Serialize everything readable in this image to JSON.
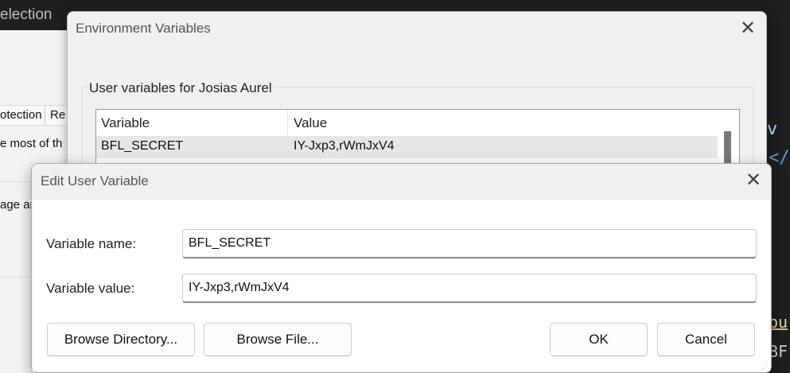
{
  "background": {
    "menubar_text": "election",
    "tabs": [
      "otection",
      "Re"
    ],
    "text_lines": [
      "e most of th",
      "age ar"
    ],
    "code_fragments": [
      "v",
      "</",
      "bu",
      "BF"
    ]
  },
  "env_dialog": {
    "title": "Environment Variables",
    "close_glyph": "✕",
    "group_label": "User variables for Josias Aurel",
    "columns": {
      "variable": "Variable",
      "value": "Value"
    },
    "rows": [
      {
        "name": "BFL_SECRET",
        "value": "IY-Jxp3,rWmJxV4"
      }
    ]
  },
  "edit_dialog": {
    "title": "Edit User Variable",
    "close_glyph": "✕",
    "name_label": "Variable name:",
    "name_value": "BFL_SECRET",
    "value_label": "Variable value:",
    "value_value": "IY-Jxp3,rWmJxV4",
    "buttons": {
      "browse_directory": "Browse Directory...",
      "browse_file": "Browse File...",
      "ok": "OK",
      "cancel": "Cancel"
    }
  },
  "colors": {
    "dialog_bg": "#f0f0f0",
    "selected_row": "#e6e6e6",
    "editor_bg": "#1f1f1f"
  }
}
